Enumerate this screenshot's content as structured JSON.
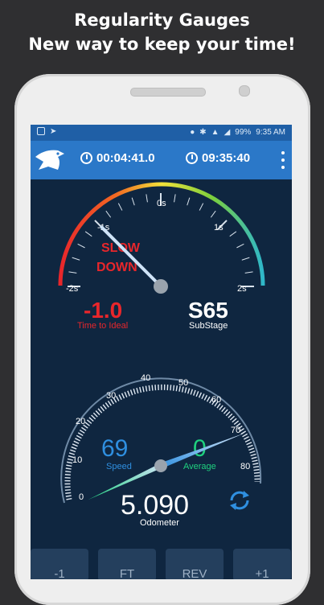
{
  "promo": {
    "line1": "Regularity Gauges",
    "line2": "New way to keep your time!"
  },
  "statusbar": {
    "battery": "99%",
    "time": "9:35 AM"
  },
  "appbar": {
    "stopwatch": "00:04:41.0",
    "clock": "09:35:40"
  },
  "regularity_gauge": {
    "ticks": [
      "-2s",
      "-1s",
      "0s",
      "1s",
      "2s"
    ],
    "warning_line1": "SLOW",
    "warning_line2": "DOWN",
    "time_to_ideal_value": "-1.0",
    "time_to_ideal_label": "Time to Ideal",
    "substage_value": "S65",
    "substage_label": "SubStage",
    "needle_value": -1.0
  },
  "speed_gauge": {
    "ticks": [
      "0",
      "10",
      "20",
      "30",
      "40",
      "50",
      "60",
      "70",
      "80"
    ],
    "speed_value": "69",
    "speed_label": "Speed",
    "average_value": "0",
    "average_label": "Average",
    "odometer_value": "5.090",
    "odometer_label": "Odometer",
    "speed_needle": 69,
    "average_needle": 0
  },
  "buttons": [
    "-1",
    "FT",
    "REV",
    "+1"
  ],
  "colors": {
    "screen_bg": "#0f2640",
    "appbar": "#2b78c8",
    "statusbar": "#1f5fa6",
    "warning_red": "#e8262b",
    "speed_blue": "#2f8fe0",
    "average_green": "#1fd17f"
  }
}
